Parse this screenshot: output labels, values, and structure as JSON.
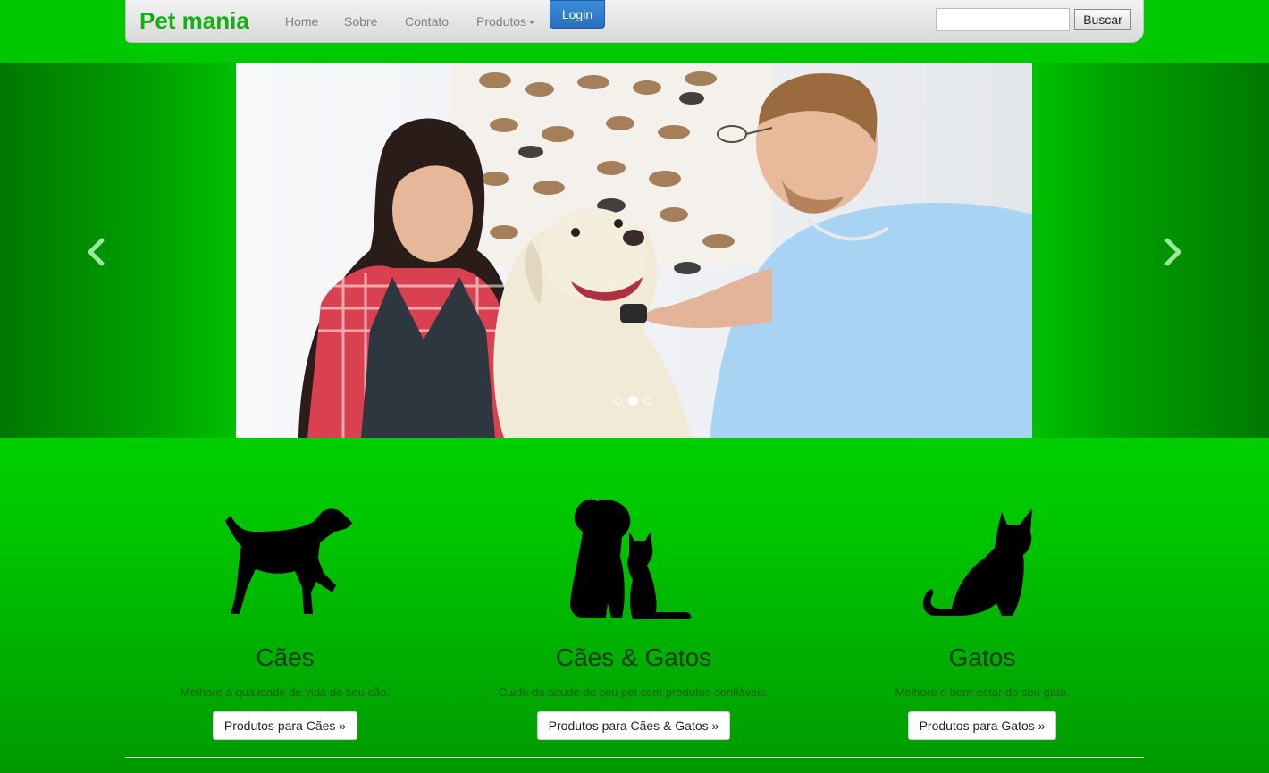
{
  "navbar": {
    "brand": "Pet mania",
    "links": [
      "Home",
      "Sobre",
      "Contato",
      "Produtos"
    ],
    "login_label": "Login",
    "search_placeholder": "",
    "search_button": "Buscar"
  },
  "carousel": {
    "slide_alt": "Veterinário examinando cachorro com a dona",
    "indicator_count": 3,
    "active_index": 1
  },
  "features": [
    {
      "title": "Cães",
      "text": "Melhore a qualidade de vida do seu cão.",
      "button": "Produtos para Cães »",
      "icon": "dog-icon"
    },
    {
      "title": "Cães & Gatos",
      "text": "Cuide da saúde do seu pet com produtos confiáveis.",
      "button": "Produtos para Cães & Gatos »",
      "icon": "dog-and-cat-icon"
    },
    {
      "title": "Gatos",
      "text": "Melhore o bem-estar do seu gato.",
      "button": "Produtos para Gatos »",
      "icon": "cat-icon"
    }
  ],
  "colors": {
    "page_green": "#00dd00",
    "brand_green": "#12b012",
    "login_blue": "#3a8ed8"
  }
}
